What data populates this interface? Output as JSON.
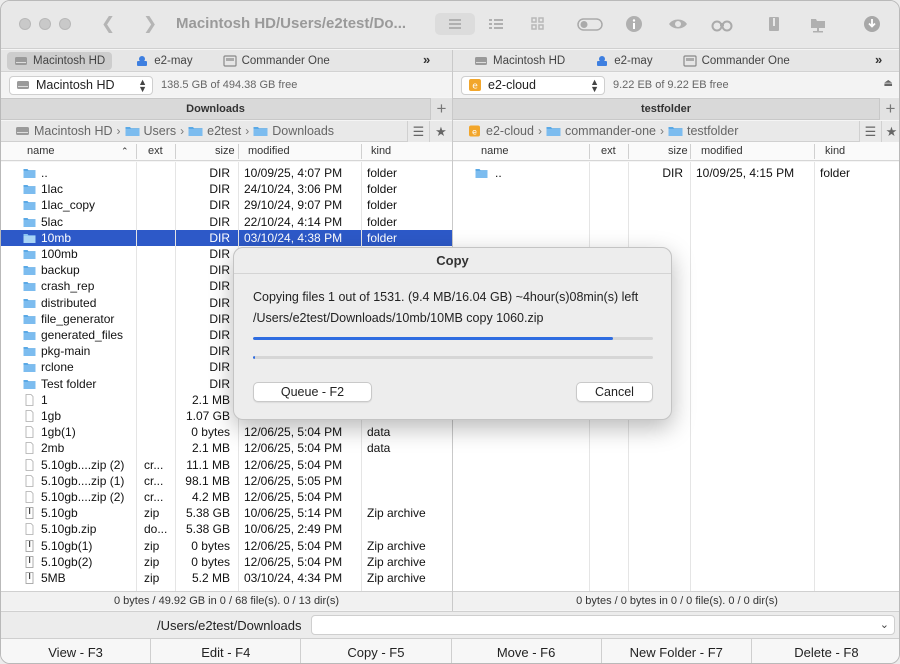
{
  "window": {
    "title": "Macintosh HD/Users/e2test/Do..."
  },
  "drive_tabs": [
    "Macintosh HD",
    "e2-may",
    "Commander One"
  ],
  "left": {
    "volume": "Macintosh HD",
    "free_space": "138.5 GB of 494.38 GB free",
    "tab_title": "Downloads",
    "breadcrumb": [
      "Macintosh HD",
      "Users",
      "e2test",
      "Downloads"
    ],
    "status": "0 bytes / 49.92 GB in 0 / 68 file(s). 0 / 13 dir(s)",
    "files": [
      {
        "name": "..",
        "ext": "",
        "size": "DIR",
        "modified": "10/09/25, 4:07 PM",
        "kind": "folder",
        "icon": "folder"
      },
      {
        "name": "1lac",
        "ext": "",
        "size": "DIR",
        "modified": "24/10/24, 3:06 PM",
        "kind": "folder",
        "icon": "folder"
      },
      {
        "name": "1lac_copy",
        "ext": "",
        "size": "DIR",
        "modified": "29/10/24, 9:07 PM",
        "kind": "folder",
        "icon": "folder"
      },
      {
        "name": "5lac",
        "ext": "",
        "size": "DIR",
        "modified": "22/10/24, 4:14 PM",
        "kind": "folder",
        "icon": "folder"
      },
      {
        "name": "10mb",
        "ext": "",
        "size": "DIR",
        "modified": "03/10/24, 4:38 PM",
        "kind": "folder",
        "icon": "folder",
        "selected": true
      },
      {
        "name": "100mb",
        "ext": "",
        "size": "DIR",
        "modified": "",
        "kind": "",
        "icon": "folder"
      },
      {
        "name": "backup",
        "ext": "",
        "size": "DIR",
        "modified": "",
        "kind": "",
        "icon": "folder"
      },
      {
        "name": "crash_rep",
        "ext": "",
        "size": "DIR",
        "modified": "",
        "kind": "",
        "icon": "folder"
      },
      {
        "name": "distributed",
        "ext": "",
        "size": "DIR",
        "modified": "",
        "kind": "",
        "icon": "folder"
      },
      {
        "name": "file_generator",
        "ext": "",
        "size": "DIR",
        "modified": "",
        "kind": "",
        "icon": "folder"
      },
      {
        "name": "generated_files",
        "ext": "",
        "size": "DIR",
        "modified": "",
        "kind": "",
        "icon": "folder"
      },
      {
        "name": "pkg-main",
        "ext": "",
        "size": "DIR",
        "modified": "",
        "kind": "",
        "icon": "folder"
      },
      {
        "name": "rclone",
        "ext": "",
        "size": "DIR",
        "modified": "",
        "kind": "",
        "icon": "folder"
      },
      {
        "name": "Test folder",
        "ext": "",
        "size": "DIR",
        "modified": "",
        "kind": "",
        "icon": "folder"
      },
      {
        "name": "1",
        "ext": "",
        "size": "2.1 MB",
        "modified": "",
        "kind": "",
        "icon": "doc"
      },
      {
        "name": "1gb",
        "ext": "",
        "size": "1.07 GB",
        "modified": "",
        "kind": "",
        "icon": "doc"
      },
      {
        "name": "1gb(1)",
        "ext": "",
        "size": "0 bytes",
        "modified": "12/06/25, 5:04 PM",
        "kind": "data",
        "icon": "doc"
      },
      {
        "name": "2mb",
        "ext": "",
        "size": "2.1 MB",
        "modified": "12/06/25, 5:04 PM",
        "kind": "data",
        "icon": "doc"
      },
      {
        "name": "5.10gb....zip (2)",
        "ext": "cr...",
        "size": "11.1 MB",
        "modified": "12/06/25, 5:04 PM",
        "kind": "",
        "icon": "doc"
      },
      {
        "name": "5.10gb....zip (1)",
        "ext": "cr...",
        "size": "98.1 MB",
        "modified": "12/06/25, 5:05 PM",
        "kind": "",
        "icon": "doc"
      },
      {
        "name": "5.10gb....zip (2)",
        "ext": "cr...",
        "size": "4.2 MB",
        "modified": "12/06/25, 5:04 PM",
        "kind": "",
        "icon": "doc"
      },
      {
        "name": "5.10gb",
        "ext": "zip",
        "size": "5.38 GB",
        "modified": "10/06/25, 5:14 PM",
        "kind": "Zip archive",
        "icon": "zip"
      },
      {
        "name": "5.10gb.zip",
        "ext": "do...",
        "size": "5.38 GB",
        "modified": "10/06/25, 2:49 PM",
        "kind": "",
        "icon": "doc"
      },
      {
        "name": "5.10gb(1)",
        "ext": "zip",
        "size": "0 bytes",
        "modified": "12/06/25, 5:04 PM",
        "kind": "Zip archive",
        "icon": "zip"
      },
      {
        "name": "5.10gb(2)",
        "ext": "zip",
        "size": "0 bytes",
        "modified": "12/06/25, 5:04 PM",
        "kind": "Zip archive",
        "icon": "zip"
      },
      {
        "name": "5MB",
        "ext": "zip",
        "size": "5.2 MB",
        "modified": "03/10/24, 4:34 PM",
        "kind": "Zip archive",
        "icon": "zip"
      }
    ]
  },
  "right": {
    "volume": "e2-cloud",
    "free_space": "9.22 EB of 9.22 EB free",
    "tab_title": "testfolder",
    "breadcrumb": [
      "e2-cloud",
      "commander-one",
      "testfolder"
    ],
    "status": "0 bytes / 0 bytes in 0 / 0 file(s). 0 / 0 dir(s)",
    "files": [
      {
        "name": "..",
        "ext": "",
        "size": "DIR",
        "modified": "10/09/25, 4:15 PM",
        "kind": "folder",
        "icon": "folder"
      }
    ]
  },
  "columns": {
    "name": "name",
    "ext": "ext",
    "size": "size",
    "modified": "modified",
    "kind": "kind"
  },
  "command_line": {
    "path": "/Users/e2test/Downloads",
    "value": ""
  },
  "fkeys": [
    "View - F3",
    "Edit - F4",
    "Copy - F5",
    "Move - F6",
    "New Folder - F7",
    "Delete - F8"
  ],
  "dialog": {
    "title": "Copy",
    "line1": "Copying files 1 out of 1531. (9.4 MB/16.04 GB) ~4hour(s)08min(s) left",
    "line2": "/Users/e2test/Downloads/10mb/10MB copy 1060.zip",
    "file_progress": 0.9,
    "total_progress": 0.005,
    "queue_label": "Queue - F2",
    "cancel_label": "Cancel"
  },
  "colors": {
    "accent": "#2f6de1",
    "selection": "#2d59c8",
    "folder": "#5aa9e6"
  }
}
